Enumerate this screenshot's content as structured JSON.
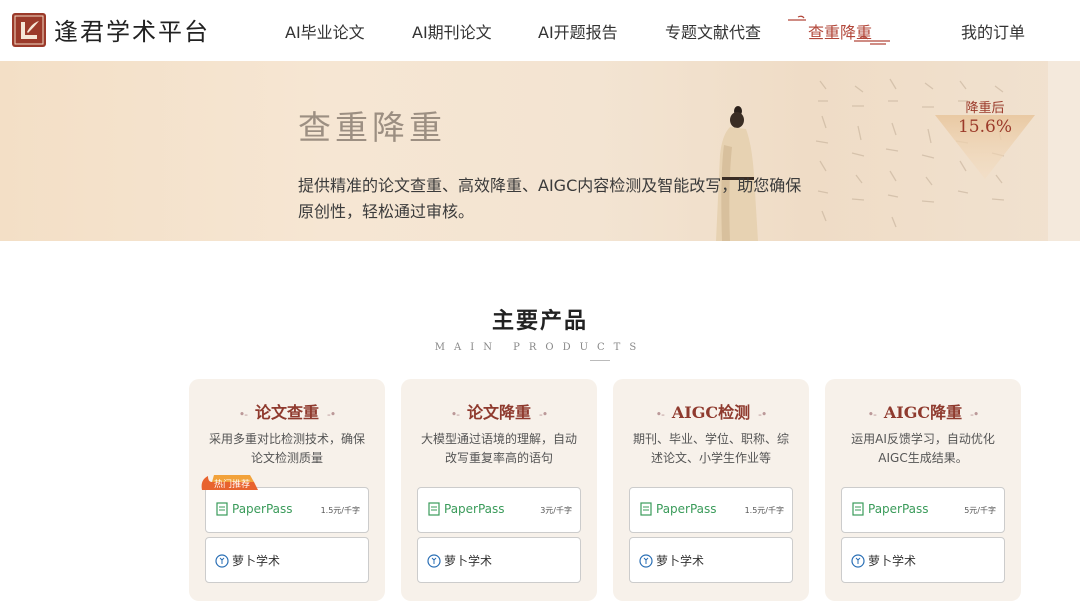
{
  "header": {
    "logo_text": "逢君学术平台",
    "nav": [
      {
        "label": "AI毕业论文",
        "active": false
      },
      {
        "label": "AI期刊论文",
        "active": false
      },
      {
        "label": "AI开题报告",
        "active": false
      },
      {
        "label": "专题文献代查",
        "active": false
      },
      {
        "label": "查重降重",
        "active": true
      },
      {
        "label": "我的订单",
        "active": false
      }
    ]
  },
  "banner": {
    "title": "查重降重",
    "description": "提供精准的论文查重、高效降重、AIGC内容检测及智能改写，助您确保原创性，轻松通过审核。",
    "badge_label": "降重后",
    "badge_value": "15.6%"
  },
  "section": {
    "title": "主要产品",
    "subtitle": "MAIN PRODUCTS"
  },
  "colors": {
    "brand": "#9b3a2a",
    "active_nav": "#b2473a",
    "card_bg": "#f7f1ea",
    "paperpass_green": "#3a9b5a"
  },
  "cards": [
    {
      "title": "论文查重",
      "desc": "采用多重对比检测技术，确保论文检测质量",
      "hot_badge": "热门推荐",
      "option1": {
        "name": "PaperPass",
        "price": "1.5元/千字"
      },
      "option2": {
        "name": "萝卜学术"
      }
    },
    {
      "title": "论文降重",
      "desc": "大模型通过语境的理解，自动改写重复率高的语句",
      "option1": {
        "name": "PaperPass",
        "price": "3元/千字"
      },
      "option2": {
        "name": "萝卜学术"
      }
    },
    {
      "title": "AIGC检测",
      "desc": "期刊、毕业、学位、职称、综述论文、小学生作业等",
      "option1": {
        "name": "PaperPass",
        "price": "1.5元/千字"
      },
      "option2": {
        "name": "萝卜学术"
      }
    },
    {
      "title": "AIGC降重",
      "desc": "运用AI反馈学习，自动优化AIGC生成结果。",
      "option1": {
        "name": "PaperPass",
        "price": "5元/千字"
      },
      "option2": {
        "name": "萝卜学术"
      }
    }
  ]
}
